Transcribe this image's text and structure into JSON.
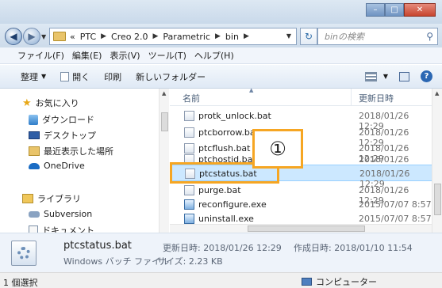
{
  "window": {
    "controls": {
      "minimize": "–",
      "maximize": "□",
      "close": "✕"
    }
  },
  "navigation": {
    "back": "◀",
    "forward": "▶",
    "breadcrumb": [
      "«",
      "PTC",
      "Creo 2.0",
      "Parametric",
      "bin"
    ],
    "refresh": "↻",
    "search_placeholder": "binの検索"
  },
  "menubar": [
    "ファイル(F)",
    "編集(E)",
    "表示(V)",
    "ツール(T)",
    "ヘルプ(H)"
  ],
  "commandbar": {
    "organize": "整理",
    "open": "開く",
    "print": "印刷",
    "new_folder": "新しいフォルダー",
    "help": "?"
  },
  "navpane": {
    "favorites": "お気に入り",
    "downloads": "ダウンロード",
    "desktop": "デスクトップ",
    "recent": "最近表示した場所",
    "onedrive": "OneDrive",
    "libraries": "ライブラリ",
    "subversion": "Subversion",
    "documents": "ドキュメント"
  },
  "filelist": {
    "col_name": "名前",
    "col_date": "更新日時",
    "rows": [
      {
        "name": "protk_unlock.bat",
        "date": "2018/01/26 12:29"
      },
      {
        "name": "ptcborrow.bat",
        "date": "2018/01/26 12:29"
      },
      {
        "name": "ptcflush.bat",
        "date": "2018/01/26 12:29"
      },
      {
        "name": "ptchostid.bat",
        "date": "2018/01/26 12:29"
      },
      {
        "name": "ptcstatus.bat",
        "date": "2018/01/26 12:29"
      },
      {
        "name": "purge.bat",
        "date": "2018/01/26 12:29"
      },
      {
        "name": "reconfigure.exe",
        "date": "2015/07/07 8:57"
      },
      {
        "name": "uninstall.exe",
        "date": "2015/07/07 8:57"
      }
    ],
    "selected_index": 4
  },
  "annotation": {
    "callout_label": "①",
    "color": "#f6a623"
  },
  "details": {
    "name": "ptcstatus.bat",
    "type": "Windows バッチ ファイル",
    "size": "サイズ: 2.23 KB",
    "modified": "更新日時: 2018/01/26 12:29",
    "created": "作成日時: 2018/01/10 11:54"
  },
  "status": {
    "selection": "1 個選択",
    "location": "コンピューター"
  }
}
